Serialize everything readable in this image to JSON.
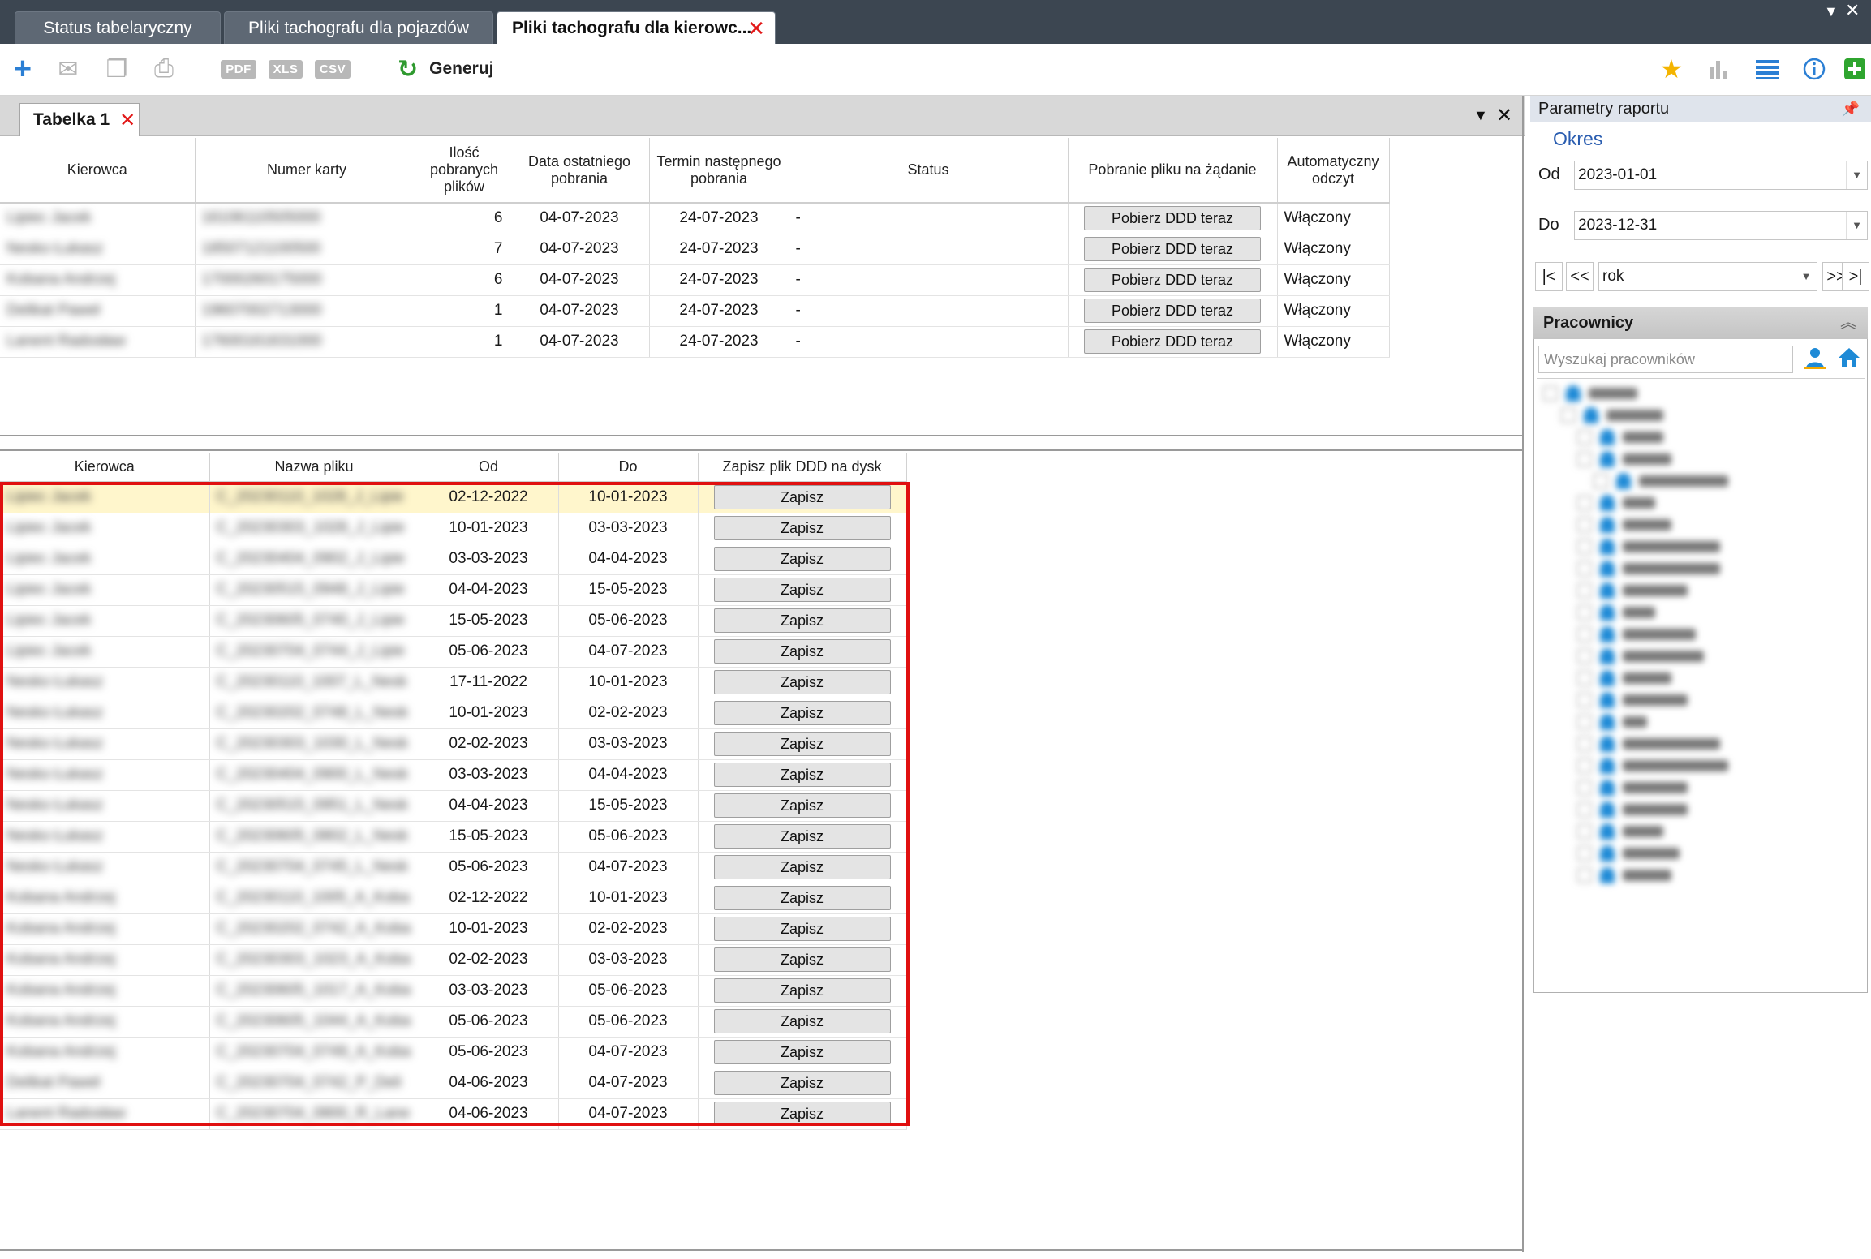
{
  "top_tabs": [
    {
      "label": "Status tabelaryczny",
      "active": false
    },
    {
      "label": "Pliki tachografu dla pojazdów",
      "active": false
    },
    {
      "label": "Pliki tachografu dla kierowc...",
      "active": true
    }
  ],
  "toolbar": {
    "pdf_label": "PDF",
    "xls_label": "XLS",
    "csv_label": "CSV",
    "generate_label": "Generuj"
  },
  "subtab": {
    "label": "Tabelka 1"
  },
  "top_table": {
    "headers": {
      "driver": "Kierowca",
      "card": "Numer karty",
      "count": "Ilość pobranych plików",
      "last": "Data ostatniego pobrania",
      "next": "Termin następnego pobrania",
      "status": "Status",
      "download": "Pobranie pliku na żądanie",
      "auto": "Automatyczny odczyt"
    },
    "rows": [
      {
        "driver": "Lipiec Jacek",
        "card": "16106110505000",
        "count": "6",
        "last": "04-07-2023",
        "next": "24-07-2023",
        "status": "-",
        "button": "Pobierz DDD teraz",
        "auto": "Włączony"
      },
      {
        "driver": "Nesko Łukasz",
        "card": "18507121100500",
        "count": "7",
        "last": "04-07-2023",
        "next": "24-07-2023",
        "status": "-",
        "button": "Pobierz DDD teraz",
        "auto": "Włączony"
      },
      {
        "driver": "Kobana Andrzej",
        "card": "17000260175000",
        "count": "6",
        "last": "04-07-2023",
        "next": "24-07-2023",
        "status": "-",
        "button": "Pobierz DDD teraz",
        "auto": "Włączony"
      },
      {
        "driver": "Delikat Paweł",
        "card": "19607002713000",
        "count": "1",
        "last": "04-07-2023",
        "next": "24-07-2023",
        "status": "-",
        "button": "Pobierz DDD teraz",
        "auto": "Włączony"
      },
      {
        "driver": "Lanent Radosław",
        "card": "17600161631000",
        "count": "1",
        "last": "04-07-2023",
        "next": "24-07-2023",
        "status": "-",
        "button": "Pobierz DDD teraz",
        "auto": "Włączony"
      }
    ]
  },
  "bottom_table": {
    "headers": {
      "driver": "Kierowca",
      "file": "Nazwa pliku",
      "from": "Od",
      "to": "Do",
      "save": "Zapisz plik DDD na dysk"
    },
    "save_label": "Zapisz",
    "rows": [
      {
        "driver": "Lipiec Jacek",
        "file": "C_20230110_1028_J_Lipie",
        "from": "02-12-2022",
        "to": "10-01-2023"
      },
      {
        "driver": "Lipiec Jacek",
        "file": "C_20230303_1028_J_Lipie",
        "from": "10-01-2023",
        "to": "03-03-2023"
      },
      {
        "driver": "Lipiec Jacek",
        "file": "C_20230404_0902_J_Lipie",
        "from": "03-03-2023",
        "to": "04-04-2023"
      },
      {
        "driver": "Lipiec Jacek",
        "file": "C_20230515_0948_J_Lipie",
        "from": "04-04-2023",
        "to": "15-05-2023"
      },
      {
        "driver": "Lipiec Jacek",
        "file": "C_20230605_0740_J_Lipie",
        "from": "15-05-2023",
        "to": "05-06-2023"
      },
      {
        "driver": "Lipiec Jacek",
        "file": "C_20230704_0744_J_Lipie",
        "from": "05-06-2023",
        "to": "04-07-2023"
      },
      {
        "driver": "Nesko Łukasz",
        "file": "C_20230110_1007_L_Nesk",
        "from": "17-11-2022",
        "to": "10-01-2023"
      },
      {
        "driver": "Nesko Łukasz",
        "file": "C_20230202_0748_L_Nesk",
        "from": "10-01-2023",
        "to": "02-02-2023"
      },
      {
        "driver": "Nesko Łukasz",
        "file": "C_20230303_1030_L_Nesk",
        "from": "02-02-2023",
        "to": "03-03-2023"
      },
      {
        "driver": "Nesko Łukasz",
        "file": "C_20230404_0900_L_Nesk",
        "from": "03-03-2023",
        "to": "04-04-2023"
      },
      {
        "driver": "Nesko Łukasz",
        "file": "C_20230515_0951_L_Nesk",
        "from": "04-04-2023",
        "to": "15-05-2023"
      },
      {
        "driver": "Nesko Łukasz",
        "file": "C_20230605_0802_L_Nesk",
        "from": "15-05-2023",
        "to": "05-06-2023"
      },
      {
        "driver": "Nesko Łukasz",
        "file": "C_20230704_0745_L_Nesk",
        "from": "05-06-2023",
        "to": "04-07-2023"
      },
      {
        "driver": "Kobana Andrzej",
        "file": "C_20230110_1005_A_Koba",
        "from": "02-12-2022",
        "to": "10-01-2023"
      },
      {
        "driver": "Kobana Andrzej",
        "file": "C_20230202_0742_A_Koba",
        "from": "10-01-2023",
        "to": "02-02-2023"
      },
      {
        "driver": "Kobana Andrzej",
        "file": "C_20230303_1023_A_Koba",
        "from": "02-02-2023",
        "to": "03-03-2023"
      },
      {
        "driver": "Kobana Andrzej",
        "file": "C_20230605_1017_A_Koba",
        "from": "03-03-2023",
        "to": "05-06-2023"
      },
      {
        "driver": "Kobana Andrzej",
        "file": "C_20230605_1044_A_Koba",
        "from": "05-06-2023",
        "to": "05-06-2023"
      },
      {
        "driver": "Kobana Andrzej",
        "file": "C_20230704_0749_A_Koba",
        "from": "05-06-2023",
        "to": "04-07-2023"
      },
      {
        "driver": "Delikat Paweł",
        "file": "C_20230704_0742_P_Deli",
        "from": "04-06-2023",
        "to": "04-07-2023"
      },
      {
        "driver": "Lanent Radosław",
        "file": "C_20230704_0800_R_Lane",
        "from": "04-06-2023",
        "to": "04-07-2023"
      }
    ]
  },
  "right_panel": {
    "title": "Parametry raportu",
    "okres_label": "Okres",
    "from_label": "Od",
    "from_value": "2023-01-01",
    "to_label": "Do",
    "to_value": "2023-12-31",
    "nav_first": "|<",
    "nav_prev": "<<",
    "period_value": "rok",
    "nav_next": ">>",
    "nav_last": ">|",
    "employees_title": "Pracownicy",
    "search_placeholder": "Wyszukaj pracowników"
  },
  "colors": {
    "highlight": "#e01010",
    "accent": "#2a5db0",
    "close": "#e21818"
  }
}
